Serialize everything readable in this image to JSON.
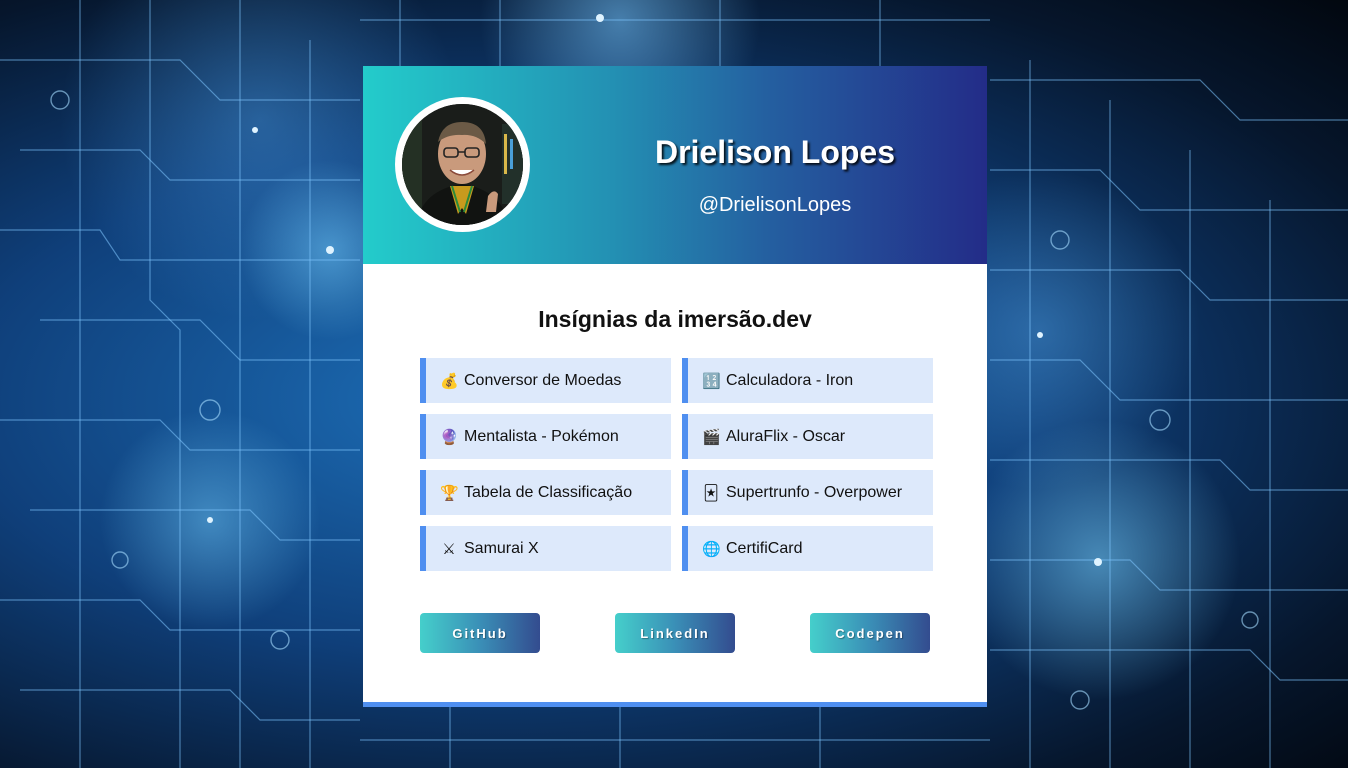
{
  "profile": {
    "name": "Drielison Lopes",
    "handle": "@DrielisonLopes"
  },
  "badges_section": {
    "title": "Insígnias da imersão.dev",
    "items": [
      {
        "icon": "money-bag-icon",
        "glyph": "💰",
        "label": "Conversor de Moedas"
      },
      {
        "icon": "numbers-icon",
        "glyph": "🔢",
        "label": "Calculadora - Iron"
      },
      {
        "icon": "crystal-ball-icon",
        "glyph": "🔮",
        "label": "Mentalista - Pokémon"
      },
      {
        "icon": "clapper-board-icon",
        "glyph": "🎬",
        "label": "AluraFlix - Oscar"
      },
      {
        "icon": "trophy-icon",
        "glyph": "🏆",
        "label": "Tabela de Classificação"
      },
      {
        "icon": "playing-card-icon",
        "glyph": "🃏",
        "label": "Supertrunfo - Overpower"
      },
      {
        "icon": "crossed-swords-icon",
        "glyph": "⚔",
        "label": "Samurai X"
      },
      {
        "icon": "globe-icon",
        "glyph": "🌐",
        "label": "CertifiCard"
      }
    ]
  },
  "links": {
    "github": "GitHub",
    "linkedin": "LinkedIn",
    "codepen": "Codepen"
  },
  "colors": {
    "accent": "#4f8ff0",
    "badge_bg": "#dde9fb",
    "header_gradient_start": "#23cccb",
    "header_gradient_end": "#232c88"
  }
}
